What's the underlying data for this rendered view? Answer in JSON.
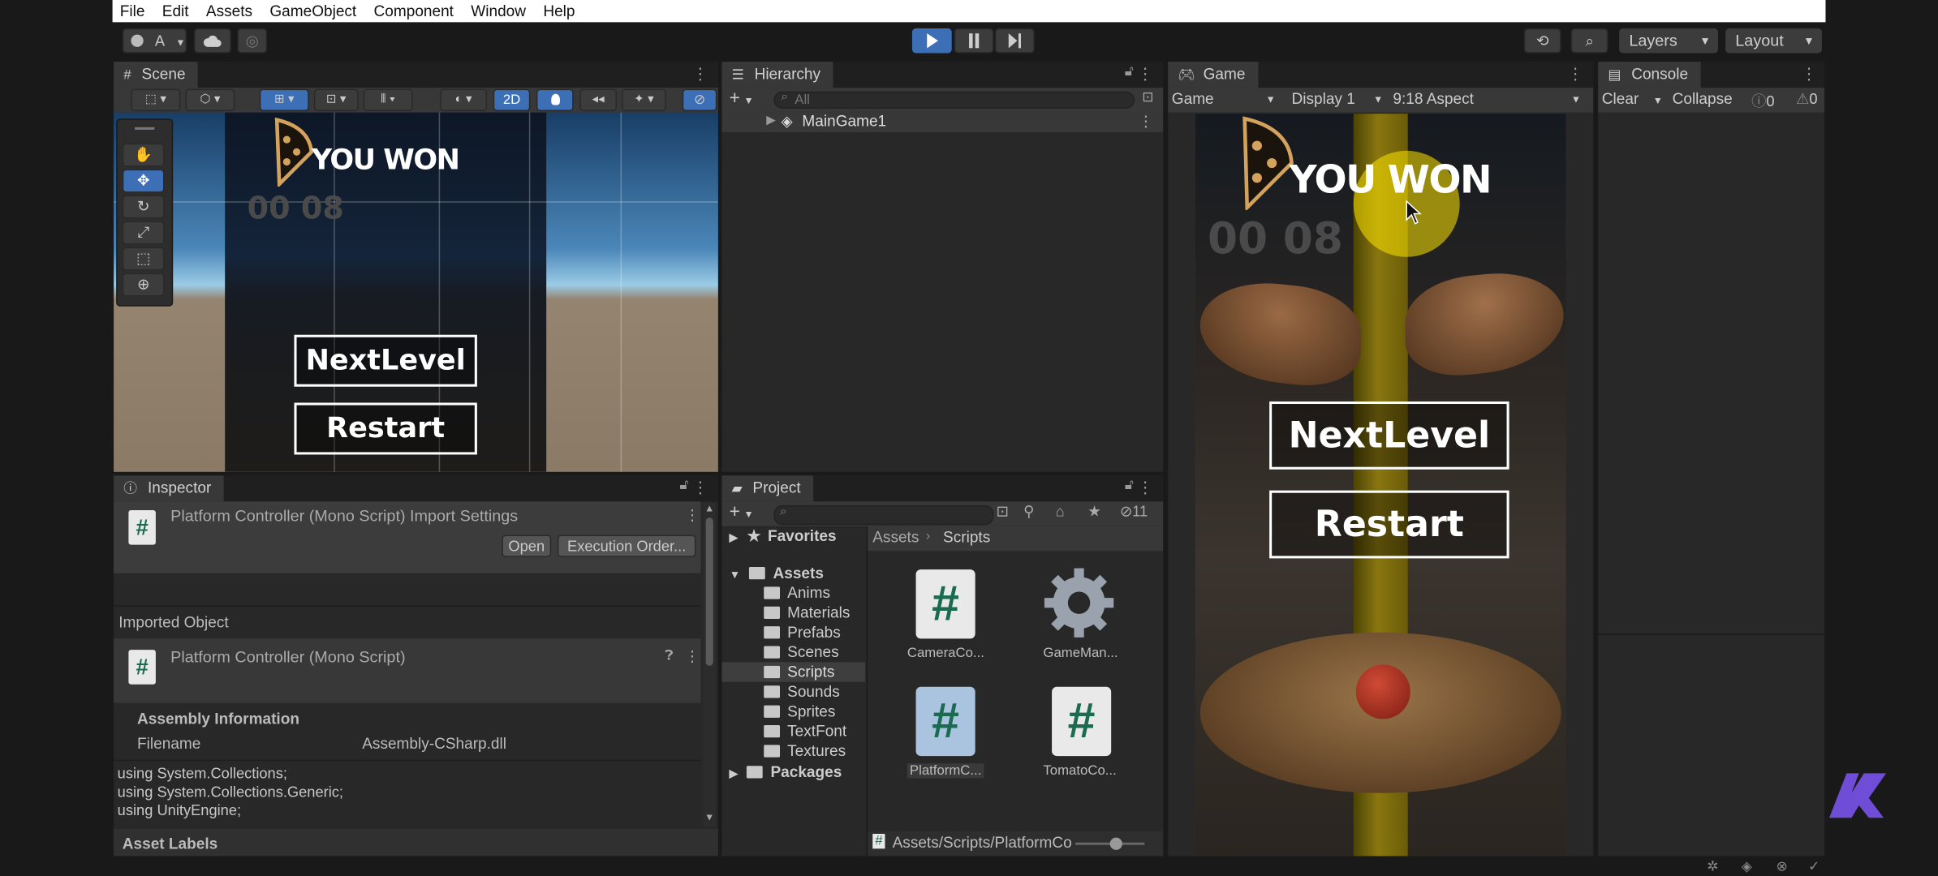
{
  "menu": [
    "File",
    "Edit",
    "Assets",
    "GameObject",
    "Component",
    "Window",
    "Help"
  ],
  "toolbar": {
    "account": "A",
    "layers": "Layers",
    "layout": "Layout"
  },
  "scene": {
    "tab": "Scene",
    "mode_2d": "2D",
    "title": "YOU WON",
    "timer": "00 08",
    "next_level": "NextLevel",
    "restart": "Restart"
  },
  "hierarchy": {
    "tab": "Hierarchy",
    "search_placeholder": "All",
    "root": "MainGame1"
  },
  "game": {
    "tab": "Game",
    "view_select": "Game",
    "display": "Display 1",
    "aspect": "9:18 Aspect",
    "title": "YOU WON",
    "timer": "00 08",
    "next_level": "NextLevel",
    "restart": "Restart"
  },
  "console": {
    "tab": "Console",
    "clear": "Clear",
    "collapse": "Collapse",
    "info_count": "0",
    "warn_count": "0"
  },
  "inspector": {
    "tab": "Inspector",
    "header_title": "Platform Controller (Mono Script) Import Settings",
    "open": "Open",
    "execution_order": "Execution Order...",
    "imported_object": "Imported Object",
    "script_name": "Platform Controller (Mono Script)",
    "assembly_info": "Assembly Information",
    "filename_label": "Filename",
    "filename_value": "Assembly-CSharp.dll",
    "code": [
      "using System.Collections;",
      "using System.Collections.Generic;",
      "using UnityEngine;"
    ],
    "asset_labels": "Asset Labels"
  },
  "project": {
    "tab": "Project",
    "hidden_count": "11",
    "favorites": "Favorites",
    "assets": "Assets",
    "folders": [
      "Anims",
      "Materials",
      "Prefabs",
      "Scenes",
      "Scripts",
      "Sounds",
      "Sprites",
      "TextFont",
      "Textures"
    ],
    "packages": "Packages",
    "breadcrumb_root": "Assets",
    "breadcrumb_current": "Scripts",
    "files": [
      "CameraCo...",
      "GameMan...",
      "PlatformC...",
      "TomatoCo..."
    ],
    "path": "Assets/Scripts/PlatformCo"
  },
  "colors": {
    "accent": "#3d6fb6",
    "panel": "#282828",
    "tab_active": "#383838"
  }
}
